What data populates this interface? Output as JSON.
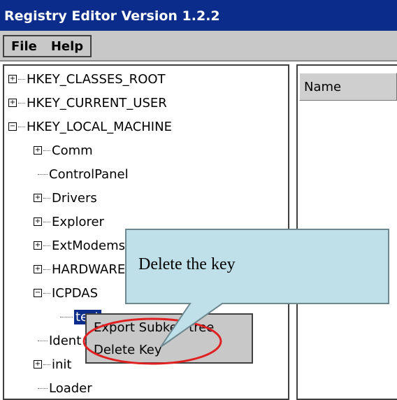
{
  "window": {
    "title": "Registry Editor Version 1.2.2"
  },
  "menu": {
    "file": "File",
    "help": "Help"
  },
  "tree": {
    "items": [
      {
        "label": "HKEY_CLASSES_ROOT",
        "expander": "+"
      },
      {
        "label": "HKEY_CURRENT_USER",
        "expander": "+"
      },
      {
        "label": "HKEY_LOCAL_MACHINE",
        "expander": "−"
      },
      {
        "label": "Comm",
        "expander": "+"
      },
      {
        "label": "ControlPanel",
        "expander": ""
      },
      {
        "label": "Drivers",
        "expander": "+"
      },
      {
        "label": "Explorer",
        "expander": "+"
      },
      {
        "label": "ExtModems",
        "expander": "+"
      },
      {
        "label": "HARDWARE",
        "expander": "+"
      },
      {
        "label": "ICPDAS",
        "expander": "−"
      },
      {
        "label": "test",
        "expander": "",
        "selected": true
      },
      {
        "label": "Ident",
        "expander": ""
      },
      {
        "label": "init",
        "expander": "+"
      },
      {
        "label": "Loader",
        "expander": ""
      }
    ]
  },
  "list": {
    "column_name": "Name"
  },
  "context_menu": {
    "items": [
      "Export Subkey tree",
      "Delete Key"
    ]
  },
  "callout": {
    "text": "Delete the key"
  },
  "colors": {
    "title_bar": "#0b2c8a",
    "callout_fill": "#bfe0e8",
    "highlight_ring": "#e02020"
  }
}
